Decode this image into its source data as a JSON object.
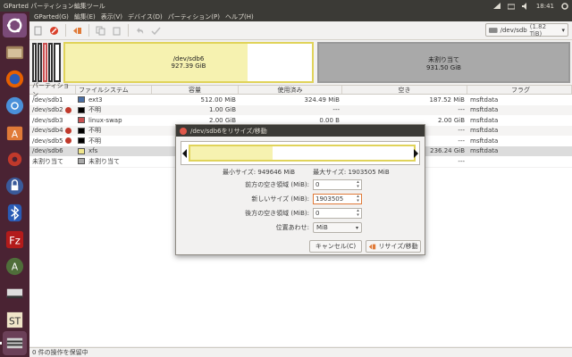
{
  "topbar": {
    "title": "GParted パーティション編集ツール",
    "time": "18:41"
  },
  "menubar": [
    "GParted(G)",
    "編集(E)",
    "表示(V)",
    "デバイス(D)",
    "パーティション(P)",
    "ヘルプ(H)"
  ],
  "device_selector": {
    "device": "/dev/sdb",
    "capacity": "(1.82 TiB)"
  },
  "graphic": {
    "sdb6": {
      "name": "/dev/sdb6",
      "size": "927.39 GiB"
    },
    "unallocated": {
      "name": "未割り当て",
      "size": "931.50 GiB"
    }
  },
  "table": {
    "headers": [
      "パーティション",
      "ファイルシステム",
      "容量",
      "使用済み",
      "空き",
      "フラグ"
    ],
    "rows": [
      {
        "partition": "/dev/sdb1",
        "warn": false,
        "fs": "ext3",
        "color": "#4a6fa5",
        "size": "512.00 MiB",
        "used": "324.49 MiB",
        "free": "187.52 MiB",
        "flags": "msftdata"
      },
      {
        "partition": "/dev/sdb2",
        "warn": true,
        "fs": "不明",
        "color": "#000000",
        "size": "1.00 GiB",
        "used": "---",
        "free": "---",
        "flags": "msftdata"
      },
      {
        "partition": "/dev/sdb3",
        "warn": false,
        "fs": "linux-swap",
        "color": "#c95050",
        "size": "2.00 GiB",
        "used": "0.00 B",
        "free": "2.00 GiB",
        "flags": "msftdata"
      },
      {
        "partition": "/dev/sdb4",
        "warn": true,
        "fs": "不明",
        "color": "#000000",
        "size": "128.00 MiB",
        "used": "---",
        "free": "---",
        "flags": "msftdata"
      },
      {
        "partition": "/dev/sdb5",
        "warn": true,
        "fs": "不明",
        "color": "#000000",
        "size": "",
        "used": "---",
        "free": "---",
        "flags": "msftdata"
      },
      {
        "partition": "/dev/sdb6",
        "warn": false,
        "fs": "xfs",
        "color": "#f0e68c",
        "size": "",
        "used": "",
        "free": "236.24 GiB",
        "flags": "msftdata"
      },
      {
        "partition": "未割り当て",
        "warn": false,
        "fs": "未割り当て",
        "color": "#a9a9a9",
        "size": "",
        "used": "---",
        "free": "---",
        "flags": ""
      }
    ]
  },
  "statusbar": "0 件の操作を保留中",
  "dialog": {
    "title": "/dev/sdb6をリサイズ/移動",
    "min_size": "最小サイズ: 949646 MiB",
    "max_size": "最大サイズ: 1903505 MiB",
    "fields": {
      "before_label": "前方の空き領域 (MiB):",
      "before_value": "0",
      "new_size_label": "新しいサイズ (MiB):",
      "new_size_value": "1903505",
      "after_label": "後方の空き領域 (MiB):",
      "after_value": "0",
      "align_label": "位置あわせ:",
      "align_value": "MiB"
    },
    "cancel_label": "キャンセル(C)",
    "resize_label": "リサイズ/移動"
  }
}
